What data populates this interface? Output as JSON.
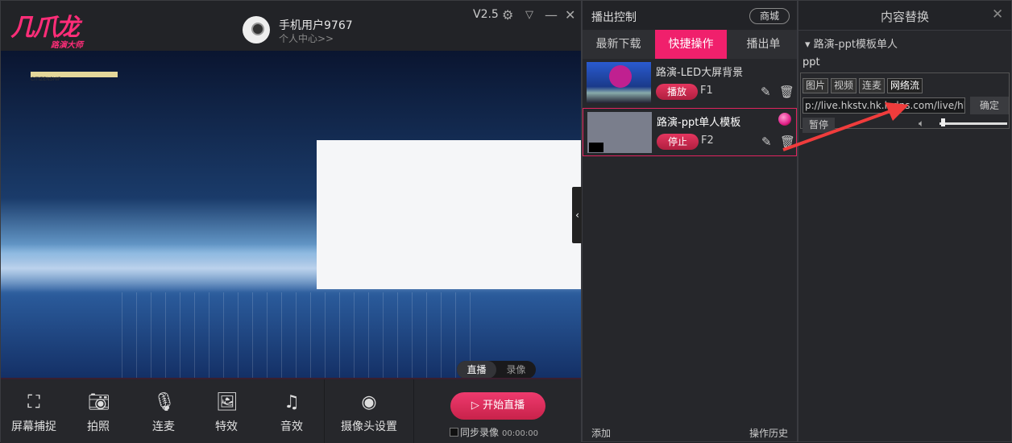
{
  "app": {
    "logo": "几爪龙",
    "logo_sub": "路演大师",
    "version": "V2.5",
    "user_name": "手机用户9767",
    "user_center": "个人中心>>"
  },
  "window_icons": [
    "gear-icon",
    "dropdown-icon",
    "minimize-icon",
    "close-icon"
  ],
  "preview": {
    "hud_label": "CITIZENSHIP",
    "mode_toggle": {
      "live": "直播",
      "record": "录像",
      "selected": "直播"
    }
  },
  "toolbar": {
    "items": [
      {
        "label": "屏幕捕捉",
        "icon": "screen-capture-icon"
      },
      {
        "label": "拍照",
        "icon": "camera-icon"
      },
      {
        "label": "连麦",
        "icon": "microphone-icon"
      },
      {
        "label": "特效",
        "icon": "image-icon"
      },
      {
        "label": "音效",
        "icon": "music-icon"
      },
      {
        "label": "摄像头设置",
        "icon": "webcam-icon"
      }
    ],
    "start_live": "开始直播",
    "sync_record": "同步录像",
    "timer": "00:00:00"
  },
  "broadcast": {
    "title": "播出控制",
    "shop": "商城",
    "tabs": [
      "最新下载",
      "快捷操作",
      "播出单"
    ],
    "active_tab": "快捷操作",
    "items": [
      {
        "name": "路演-LED大屏背景",
        "action": "播放",
        "key": "F1"
      },
      {
        "name": "路演-ppt单人模板",
        "action": "停止",
        "key": "F2",
        "selected": true
      }
    ],
    "add": "添加",
    "history": "操作历史"
  },
  "content": {
    "title": "内容替换",
    "tree_item": "路演-ppt模板单人",
    "layer": "ppt",
    "tabs": [
      "图片",
      "视频",
      "连麦",
      "网络流"
    ],
    "active_tab": "网络流",
    "url": "p://live.hkstv.hk.lxdns.com/live/hks",
    "confirm": "确定",
    "pause": "暂停",
    "volume": 0.02
  },
  "colors": {
    "accent": "#f0206c",
    "button": "#d02a52"
  }
}
